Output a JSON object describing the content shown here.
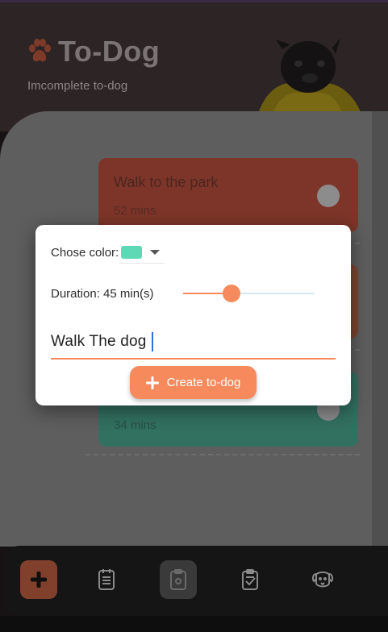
{
  "app": {
    "title": "To-Dog",
    "subtitle": "Imcomplete to-dog"
  },
  "cards": [
    {
      "title": "Walk to the park",
      "duration": "52 mins",
      "color": "#e56a55"
    },
    {
      "title": "",
      "duration": "",
      "color": "#f2875e"
    },
    {
      "title": "",
      "duration": "34 mins",
      "color": "#5fd6b1"
    }
  ],
  "dialog": {
    "color_label": "Chose color:",
    "selected_color": "#5ed9b5",
    "duration_label": "Duration: 45 min(s)",
    "duration_value": 45,
    "duration_fraction": 0.37,
    "input_value": "Walk The dog",
    "create_label": "Create to-dog"
  },
  "colors": {
    "accent": "#f68a5d",
    "overlay": "rgba(0,0,0,0.6)"
  },
  "nav": [
    {
      "icon": "plus-icon"
    },
    {
      "icon": "notes-icon"
    },
    {
      "icon": "clipboard-icon"
    },
    {
      "icon": "clipboard-check-icon"
    },
    {
      "icon": "dog-face-icon"
    }
  ]
}
